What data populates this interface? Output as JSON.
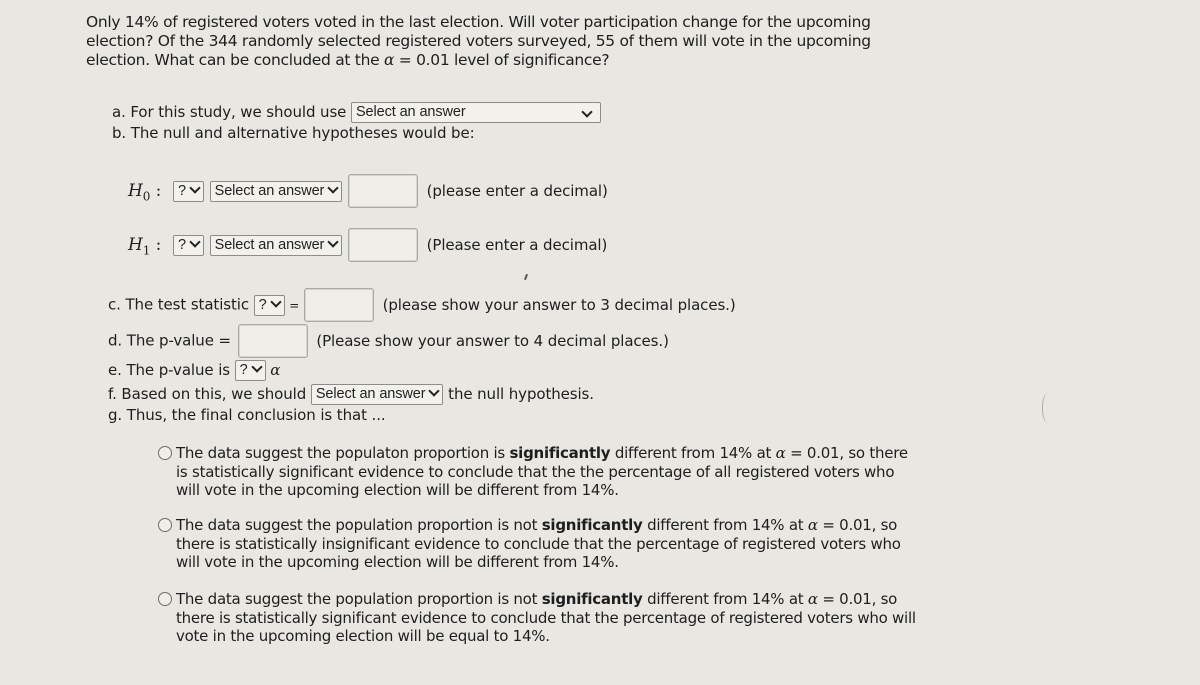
{
  "question": {
    "prompt_part1": "Only 14% of registered voters voted in the last election. Will voter participation change for the upcoming election? Of the 344 randomly selected registered voters surveyed, 55 of them will vote in the upcoming election. What can be concluded at the ",
    "alpha_symbol": "α",
    "prompt_part2": " = 0.01 level of significance?"
  },
  "part_a": {
    "label": "a. For this study, we should use",
    "select_value": "Select an answer"
  },
  "part_b": {
    "label": "b. The null and alternative hypotheses would be:"
  },
  "hypotheses": {
    "h0": {
      "symbol": "H",
      "subscript": "0",
      "colon": ":",
      "op_select": "?",
      "param_select": "Select an answer",
      "value": "",
      "hint": "(please enter a decimal)"
    },
    "h1": {
      "symbol": "H",
      "subscript": "1",
      "colon": ":",
      "op_select": "?",
      "param_select": "Select an answer",
      "value": "",
      "hint": "(Please enter a decimal)"
    }
  },
  "part_c": {
    "label": "c. The test statistic",
    "select_value": "?",
    "equals": "=",
    "value": "",
    "hint": "(please show your answer to 3 decimal places.)"
  },
  "part_d": {
    "label": "d. The p-value =",
    "value": "",
    "hint": "(Please show your answer to 4 decimal places.)"
  },
  "part_e": {
    "label": "e. The p-value is",
    "select_value": "?",
    "alpha_symbol": "α"
  },
  "part_f": {
    "label": "f. Based on this, we should",
    "select_value": "Select an answer",
    "suffix": "the null hypothesis."
  },
  "part_g": {
    "label": "g. Thus, the final conclusion is that ..."
  },
  "conclusion_options": [
    {
      "pre": "The data suggest the populaton proportion is ",
      "bold": "significantly",
      "mid": " different from 14% at ",
      "alpha": "α",
      "post": " = 0.01, so there is statistically significant evidence to conclude that the the percentage of all registered voters who will vote in the upcoming election will be different from 14%.",
      "selected": false
    },
    {
      "pre": "The data suggest the population proportion is not ",
      "bold": "significantly",
      "mid": " different from 14% at ",
      "alpha": "α",
      "post": " = 0.01, so there is statistically insignificant evidence to conclude that the percentage of registered voters who will vote in the upcoming election will be different from 14%.",
      "selected": false
    },
    {
      "pre": "The data suggest the population proportion is not ",
      "bold": "significantly",
      "mid": " different from 14% at ",
      "alpha": "α",
      "post": " = 0.01, so there is statistically significant evidence to conclude that the percentage of registered voters who will vote in the upcoming election will be equal to 14%.",
      "selected": false
    }
  ]
}
